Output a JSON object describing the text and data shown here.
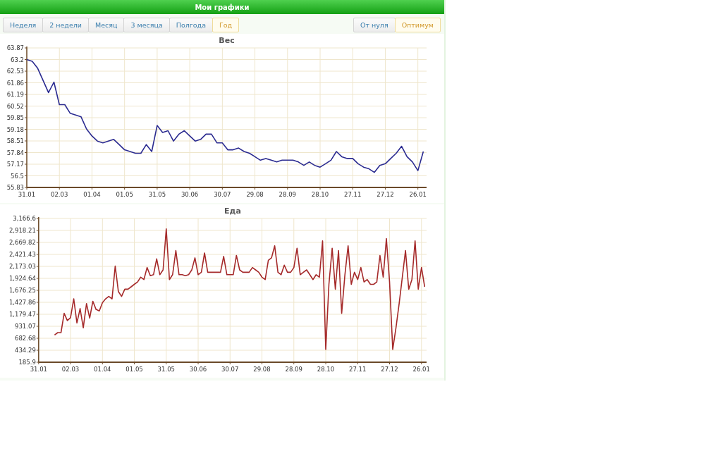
{
  "header": {
    "title": "Мои графики"
  },
  "period_tabs": [
    {
      "label": "Неделя",
      "selected": false
    },
    {
      "label": "2 недели",
      "selected": false
    },
    {
      "label": "Месяц",
      "selected": false
    },
    {
      "label": "3 месяца",
      "selected": false
    },
    {
      "label": "Полгода",
      "selected": false
    },
    {
      "label": "Год",
      "selected": true
    }
  ],
  "scale_tabs": [
    {
      "label": "От нуля",
      "selected": false
    },
    {
      "label": "Оптимум",
      "selected": true
    }
  ],
  "charts": [
    {
      "chart_data": {
        "type": "line",
        "title": "Вес",
        "grid": true,
        "ylim": [
          55.83,
          63.87
        ],
        "yticks": [
          55.83,
          56.5,
          57.17,
          57.84,
          58.51,
          59.18,
          59.85,
          60.52,
          61.19,
          61.86,
          62.53,
          63.2,
          63.87
        ],
        "categories": [
          "31.01",
          null,
          null,
          null,
          null,
          null,
          "02.03",
          null,
          null,
          null,
          null,
          null,
          "01.04",
          null,
          null,
          null,
          null,
          null,
          "01.05",
          null,
          null,
          null,
          null,
          null,
          "31.05",
          null,
          null,
          null,
          null,
          null,
          "30.06",
          null,
          null,
          null,
          null,
          null,
          "30.07",
          null,
          null,
          null,
          null,
          null,
          "29.08",
          null,
          null,
          null,
          null,
          null,
          "28.09",
          null,
          null,
          null,
          null,
          null,
          "28.10",
          null,
          null,
          null,
          null,
          null,
          "27.11",
          null,
          null,
          null,
          null,
          null,
          "27.12",
          null,
          null,
          null,
          null,
          null,
          "26.01",
          null
        ],
        "series": [
          {
            "color": "#2b2b90",
            "values": [
              63.2,
              63.1,
              62.7,
              62.0,
              61.3,
              61.9,
              60.6,
              60.6,
              60.1,
              60.0,
              59.9,
              59.2,
              58.8,
              58.5,
              58.4,
              58.5,
              58.6,
              58.3,
              58.0,
              57.9,
              57.8,
              57.8,
              58.3,
              57.9,
              59.4,
              59.0,
              59.1,
              58.5,
              58.9,
              59.1,
              58.8,
              58.5,
              58.6,
              58.9,
              58.9,
              58.4,
              58.4,
              58.0,
              58.0,
              58.1,
              57.9,
              57.8,
              57.6,
              57.4,
              57.5,
              57.4,
              57.3,
              57.4,
              57.4,
              57.4,
              57.3,
              57.1,
              57.3,
              57.1,
              57.0,
              57.2,
              57.4,
              57.9,
              57.6,
              57.5,
              57.5,
              57.2,
              57.0,
              56.9,
              56.7,
              57.1,
              57.2,
              57.5,
              57.8,
              58.2,
              57.6,
              57.3,
              56.8,
              57.9
            ]
          }
        ]
      }
    },
    {
      "chart_data": {
        "type": "line",
        "title": "Еда",
        "grid": true,
        "ylim": [
          185.9,
          3166.6
        ],
        "yticks": [
          185.9,
          {
            "value": 434.29,
            "label": "434.29"
          },
          {
            "value": 682.68,
            "label": "682.68"
          },
          {
            "value": 931.07,
            "label": "931.07"
          },
          {
            "value": 1179.47,
            "label": "1,179.47"
          },
          {
            "value": 1427.86,
            "label": "1,427.86"
          },
          {
            "value": 1676.25,
            "label": "1,676.25"
          },
          {
            "value": 1924.64,
            "label": "1,924.64"
          },
          {
            "value": 2173.03,
            "label": "2,173.03"
          },
          {
            "value": 2421.43,
            "label": "2,421.43"
          },
          {
            "value": 2669.82,
            "label": "2,669.82"
          },
          {
            "value": 2918.21,
            "label": "2,918.21"
          },
          {
            "value": 3166.6,
            "label": "3,166.6"
          }
        ],
        "categories": [
          "31.01",
          null,
          null,
          null,
          null,
          null,
          null,
          null,
          null,
          null,
          "02.03",
          null,
          null,
          null,
          null,
          null,
          null,
          null,
          null,
          null,
          "01.04",
          null,
          null,
          null,
          null,
          null,
          null,
          null,
          null,
          null,
          "01.05",
          null,
          null,
          null,
          null,
          null,
          null,
          null,
          null,
          null,
          "31.05",
          null,
          null,
          null,
          null,
          null,
          null,
          null,
          null,
          null,
          "30.06",
          null,
          null,
          null,
          null,
          null,
          null,
          null,
          null,
          null,
          "30.07",
          null,
          null,
          null,
          null,
          null,
          null,
          null,
          null,
          null,
          "29.08",
          null,
          null,
          null,
          null,
          null,
          null,
          null,
          null,
          null,
          "28.09",
          null,
          null,
          null,
          null,
          null,
          null,
          null,
          null,
          null,
          "28.10",
          null,
          null,
          null,
          null,
          null,
          null,
          null,
          null,
          null,
          "27.11",
          null,
          null,
          null,
          null,
          null,
          null,
          null,
          null,
          null,
          "27.12",
          null,
          null,
          null,
          null,
          null,
          null,
          null,
          null,
          null,
          "26.01",
          null
        ],
        "series": [
          {
            "color": "#a52a2a",
            "values": [
              null,
              null,
              null,
              null,
              null,
              750,
              800,
              800,
              1200,
              1050,
              1110,
              1500,
              1000,
              1300,
              900,
              1400,
              1100,
              1450,
              1280,
              1250,
              1420,
              1500,
              1550,
              1500,
              2180,
              1650,
              1550,
              1700,
              1700,
              1750,
              1800,
              1850,
              1950,
              1900,
              2150,
              1980,
              2000,
              2330,
              2000,
              2100,
              2950,
              1900,
              2000,
              2500,
              2000,
              2000,
              1980,
              2000,
              2100,
              2350,
              2000,
              2050,
              2450,
              2050,
              2050,
              2050,
              2050,
              2050,
              2380,
              2000,
              2000,
              2000,
              2400,
              2100,
              2050,
              2050,
              2050,
              2150,
              2100,
              2050,
              1950,
              1900,
              2300,
              2350,
              2600,
              2050,
              2000,
              2200,
              2050,
              2050,
              2150,
              2550,
              2000,
              2050,
              2100,
              2000,
              1900,
              2000,
              1950,
              2700,
              450,
              1800,
              2550,
              1700,
              2500,
              1200,
              2000,
              2600,
              1800,
              2050,
              1900,
              2150,
              1850,
              1900,
              1800,
              1800,
              1850,
              2400,
              1950,
              2750,
              1850,
              450,
              900,
              1400,
              1950,
              2500,
              1700,
              1900,
              2700,
              1700,
              2150,
              1750
            ]
          }
        ]
      }
    }
  ]
}
